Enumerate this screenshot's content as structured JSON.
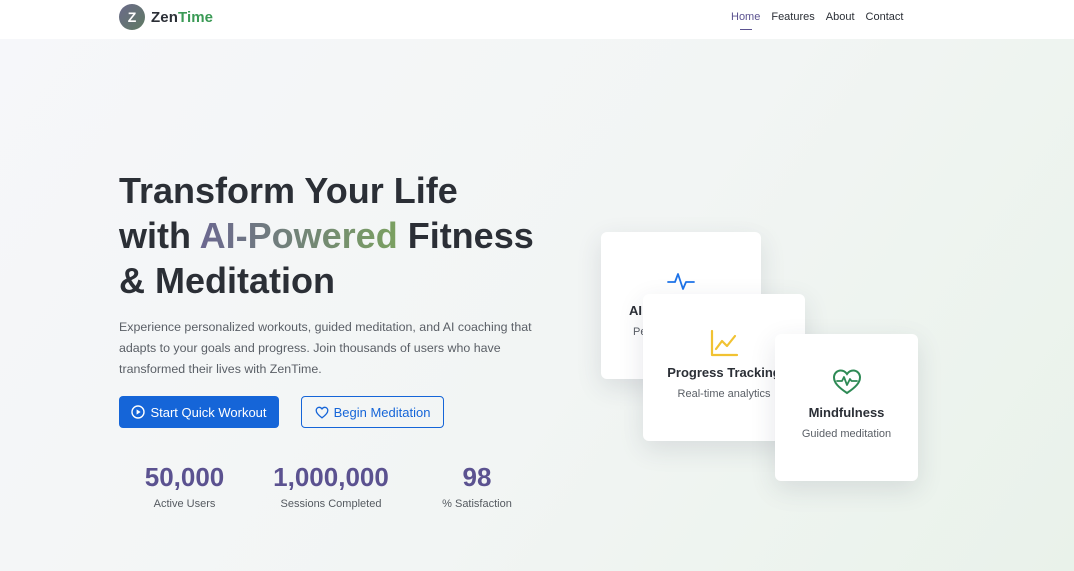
{
  "brand": {
    "logo_letter": "Z",
    "name_part1": "Zen",
    "name_part2": "Time",
    "name_part2_color": "#3a9a55"
  },
  "nav": {
    "links": [
      "Home",
      "Features",
      "About",
      "Contact"
    ],
    "active": "Home"
  },
  "hero": {
    "title_line1": "Transform Your Life",
    "title_with": "with ",
    "title_highlight": "AI-Powered",
    "title_after": " Fitness",
    "title_line3": "& Meditation",
    "subtitle": "Experience personalized workouts, guided meditation, and AI coaching that adapts to your goals and progress. Join thousands of users who have transformed their lives with ZenTime."
  },
  "buttons": {
    "primary_label": "Start Quick Workout",
    "secondary_label": "Begin Meditation"
  },
  "stats": [
    {
      "value": "50,000",
      "label": "Active Users"
    },
    {
      "value": "1,000,000",
      "label": "Sessions Completed"
    },
    {
      "value": "98",
      "label": "% Satisfaction"
    }
  ],
  "cards": [
    {
      "icon": "activity-icon",
      "title": "AI",
      "subtitle": "Pe"
    },
    {
      "icon": "chart-line-icon",
      "title": "Progress Tracking",
      "subtitle": "Real-time analytics"
    },
    {
      "icon": "heart-pulse-icon",
      "title": "Mindfulness",
      "subtitle": "Guided meditation"
    }
  ],
  "colors": {
    "primary": "#1565d8",
    "accent": "#5b5290",
    "green": "#3a9a55",
    "chart_icon": "#f1c232",
    "activity_icon": "#1e73e8",
    "heart_icon": "#2e8a55"
  }
}
